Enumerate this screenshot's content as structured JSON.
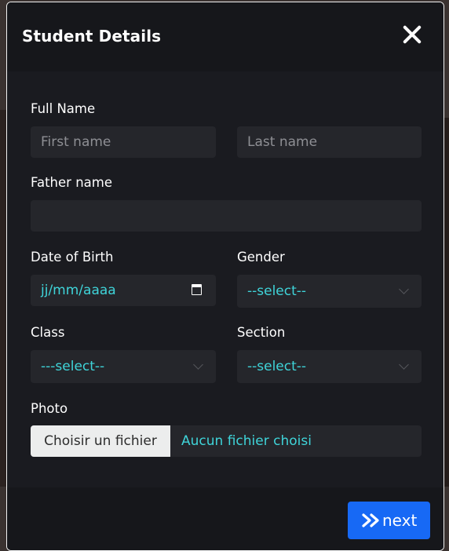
{
  "modal": {
    "title": "Student Details"
  },
  "form": {
    "full_name_label": "Full Name",
    "first_name_placeholder": "First name",
    "last_name_placeholder": "Last name",
    "father_name_label": "Father name",
    "father_name_value": "",
    "dob_label": "Date of Birth",
    "dob_value": "jj/mm/aaaa",
    "gender_label": "Gender",
    "gender_selected": "--select--",
    "class_label": "Class",
    "class_selected": "---select--",
    "section_label": "Section",
    "section_selected": "--select--",
    "photo_label": "Photo",
    "file_button_label": "Choisir un fichier",
    "file_status": "Aucun fichier choisi"
  },
  "footer": {
    "next_label": "next"
  },
  "colors": {
    "accent": "#1769f5",
    "value_text": "#3fd4d9",
    "panel": "#1a1b20",
    "field": "#25262b"
  },
  "icons": {
    "close": "close-icon",
    "next": "double-chevron-right-icon",
    "calendar": "calendar-icon"
  }
}
